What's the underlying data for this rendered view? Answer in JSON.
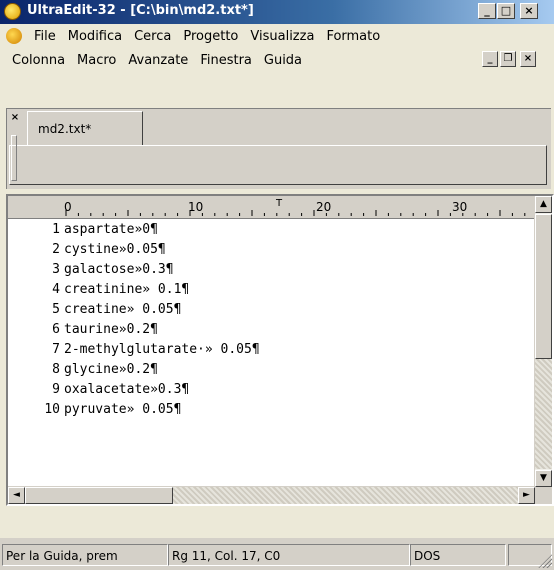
{
  "window": {
    "title": "UltraEdit-32 - [C:\\bin\\md2.txt*]"
  },
  "titlebar_buttons": {
    "minimize": "_",
    "maximize": "□",
    "close": "×"
  },
  "menu": {
    "row1": [
      "File",
      "Modifica",
      "Cerca",
      "Progetto",
      "Visualizza",
      "Formato"
    ],
    "row2": [
      "Colonna",
      "Macro",
      "Avanzate",
      "Finestra",
      "Guida"
    ]
  },
  "mdi_buttons": {
    "minimize": "_",
    "restore": "❐",
    "close": "×"
  },
  "tab": {
    "close": "×",
    "label": "md2.txt*"
  },
  "ruler": {
    "labels": [
      "0",
      "10",
      "20",
      "30"
    ],
    "marker": "T"
  },
  "lines": [
    {
      "n": "1",
      "text": "aspartate»0¶"
    },
    {
      "n": "2",
      "text": "cystine»0.05¶"
    },
    {
      "n": "3",
      "text": "galactose»0.3¶"
    },
    {
      "n": "4",
      "text": "creatinine» 0.1¶"
    },
    {
      "n": "5",
      "text": "creatine» 0.05¶"
    },
    {
      "n": "6",
      "text": "taurine»0.2¶"
    },
    {
      "n": "7",
      "text": "2-methylglutarate·» 0.05¶"
    },
    {
      "n": "8",
      "text": "glycine»0.2¶"
    },
    {
      "n": "9",
      "text": "oxalacetate»0.3¶"
    },
    {
      "n": "10",
      "text": "pyruvate» 0.05¶"
    }
  ],
  "scroll_arrows": {
    "up": "▲",
    "down": "▼",
    "left": "◄",
    "right": "►"
  },
  "status": {
    "help": "Per la Guida, prem",
    "position": "Rg 11, Col. 17, C0",
    "format": "DOS"
  }
}
